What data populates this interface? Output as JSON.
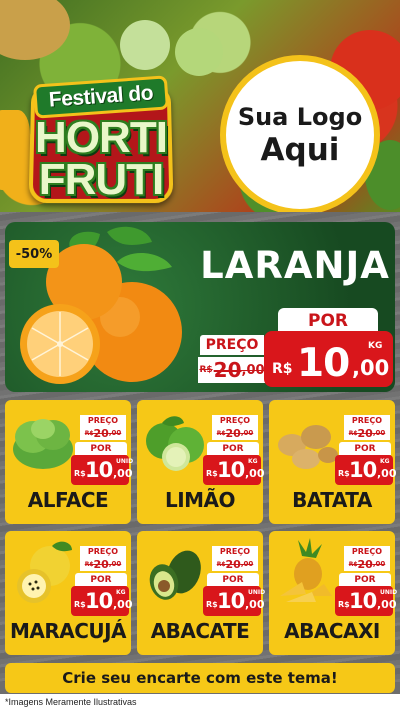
{
  "header": {
    "festival_text": "Festival do",
    "horti_text": "HORTI",
    "fruti_text": "FRUTI",
    "logo_line1": "Sua Logo",
    "logo_line2": "Aqui"
  },
  "featured": {
    "discount": "-50%",
    "name": "LARANJA",
    "preco_label": "PREÇO",
    "old_currency": "R$",
    "old_value": "20",
    "old_cents": ",00",
    "por_label": "POR",
    "currency": "R$",
    "value": "10",
    "cents": ",00",
    "unit": "KG"
  },
  "cards": [
    {
      "name": "ALFACE",
      "preco_label": "PREÇO",
      "old_currency": "R$",
      "old_value": "20",
      "old_cents": ",00",
      "por_label": "POR",
      "currency": "R$",
      "value": "10",
      "cents": ",00",
      "unit": "UNID"
    },
    {
      "name": "LIMÃO",
      "preco_label": "PREÇO",
      "old_currency": "R$",
      "old_value": "20",
      "old_cents": ",00",
      "por_label": "POR",
      "currency": "R$",
      "value": "10",
      "cents": ",00",
      "unit": "KG"
    },
    {
      "name": "BATATA",
      "preco_label": "PREÇO",
      "old_currency": "R$",
      "old_value": "20",
      "old_cents": ",00",
      "por_label": "POR",
      "currency": "R$",
      "value": "10",
      "cents": ",00",
      "unit": "KG"
    },
    {
      "name": "MARACUJÁ",
      "preco_label": "PREÇO",
      "old_currency": "R$",
      "old_value": "20",
      "old_cents": ",00",
      "por_label": "POR",
      "currency": "R$",
      "value": "10",
      "cents": ",00",
      "unit": "KG"
    },
    {
      "name": "ABACATE",
      "preco_label": "PREÇO",
      "old_currency": "R$",
      "old_value": "20",
      "old_cents": ",00",
      "por_label": "POR",
      "currency": "R$",
      "value": "10",
      "cents": ",00",
      "unit": "UNID"
    },
    {
      "name": "ABACAXI",
      "preco_label": "PREÇO",
      "old_currency": "R$",
      "old_value": "20",
      "old_cents": ",00",
      "por_label": "POR",
      "currency": "R$",
      "value": "10",
      "cents": ",00",
      "unit": "UNID"
    }
  ],
  "footer": {
    "cta": "Crie seu encarte com este tema!",
    "disclaimer": "*Imagens Meramente Ilustrativas"
  },
  "colors": {
    "yellow": "#f6c817",
    "red": "#d9161b",
    "green": "#1f5e2c"
  }
}
